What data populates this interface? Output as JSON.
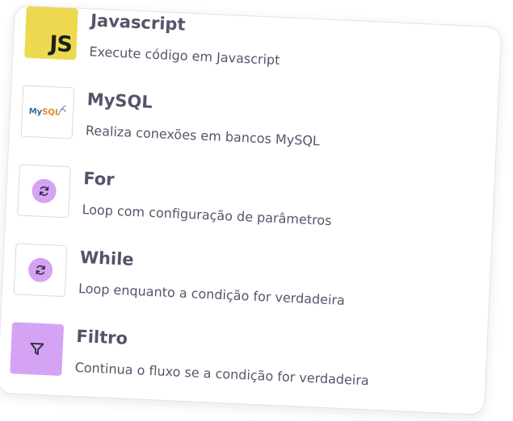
{
  "nodes": [
    {
      "title": "Javascript",
      "description": "Execute código em Javascript",
      "icon": "javascript-logo-icon",
      "logo_text": "JS"
    },
    {
      "title": "MySQL",
      "description": "Realiza conexões em bancos MySQL",
      "icon": "mysql-logo-icon",
      "logo_text_1": "My",
      "logo_text_2": "SQL"
    },
    {
      "title": "For",
      "description": "Loop com configuração de parâmetros",
      "icon": "refresh-icon"
    },
    {
      "title": "While",
      "description": "Loop enquanto a condição for verdadeira",
      "icon": "refresh-icon"
    },
    {
      "title": "Filtro",
      "description": "Continua o fluxo se a condição for verdadeira",
      "icon": "filter-icon"
    }
  ],
  "colors": {
    "javascript_tile": "#ecd94f",
    "accent_purple": "#d5a3f3",
    "title_text": "#54546a",
    "description_text": "#55556a",
    "mysql_blue": "#2e6e9b",
    "mysql_orange": "#e08a1e"
  }
}
